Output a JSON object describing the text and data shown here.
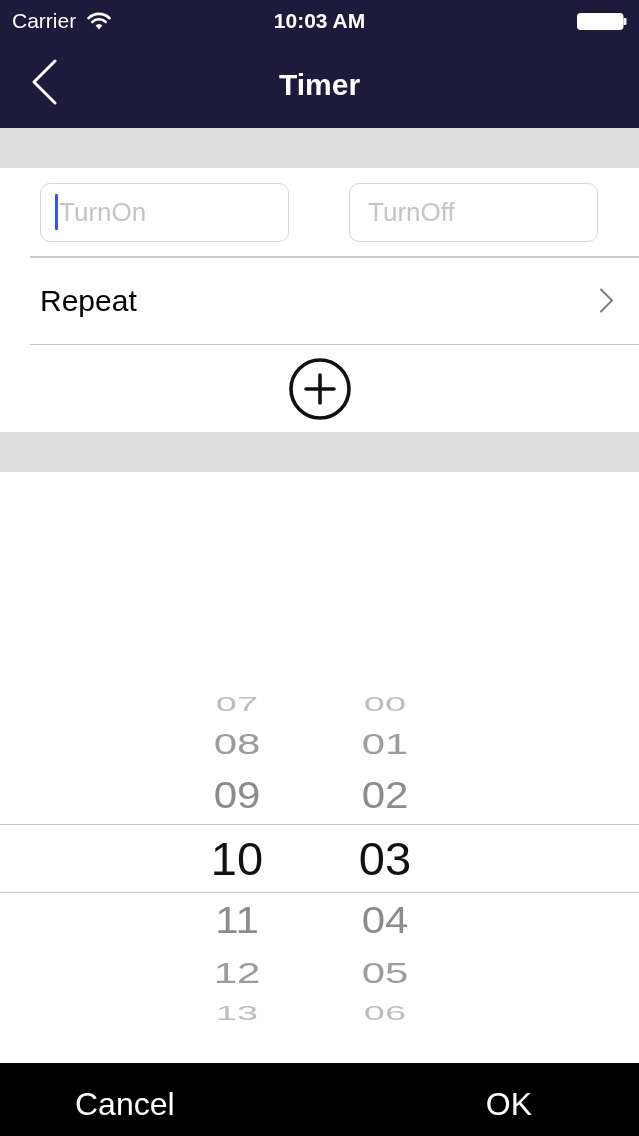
{
  "status_bar": {
    "carrier": "Carrier",
    "time": "10:03 AM"
  },
  "nav_bar": {
    "title": "Timer"
  },
  "timer_form": {
    "fields": [
      {
        "placeholder": "TurnOn",
        "focused": true
      },
      {
        "placeholder": "TurnOff",
        "focused": false
      }
    ],
    "repeat_label": "Repeat"
  },
  "time_picker": {
    "columns": [
      {
        "items": [
          {
            "label": "07",
            "selected": false
          },
          {
            "label": "08",
            "selected": false
          },
          {
            "label": "09",
            "selected": false
          },
          {
            "label": "10",
            "selected": true
          },
          {
            "label": "11",
            "selected": false
          },
          {
            "label": "12",
            "selected": false
          },
          {
            "label": "13",
            "selected": false
          }
        ]
      },
      {
        "items": [
          {
            "label": "00",
            "selected": false
          },
          {
            "label": "01",
            "selected": false
          },
          {
            "label": "02",
            "selected": false
          },
          {
            "label": "03",
            "selected": true
          },
          {
            "label": "04",
            "selected": false
          },
          {
            "label": "05",
            "selected": false
          },
          {
            "label": "06",
            "selected": false
          }
        ]
      }
    ]
  },
  "bottom_bar": {
    "buttons": [
      "Cancel",
      "OK"
    ]
  }
}
